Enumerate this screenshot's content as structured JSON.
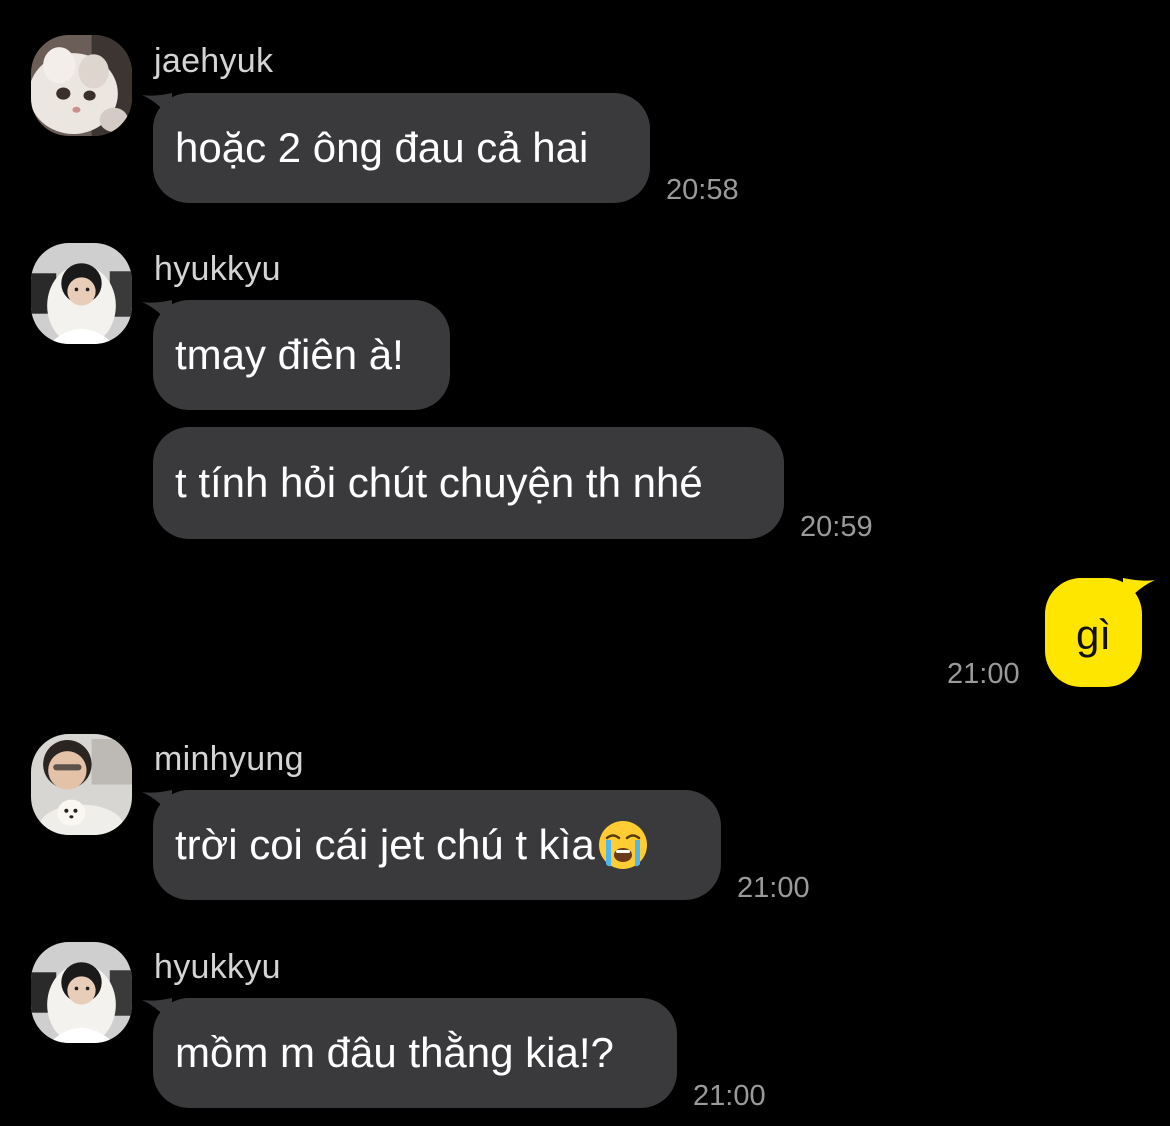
{
  "theme": {
    "background": "#000000",
    "incoming_bubble": "#3a3a3c",
    "outgoing_bubble": "#ffe600",
    "timestamp_color": "#9a9a9a",
    "sender_color": "#d4d4d4"
  },
  "messages": [
    {
      "sender": "jaehyuk",
      "avatar_icon": "cat-avatar-icon",
      "text": "hoặc 2 ông đau cả hai",
      "time": "20:58"
    },
    {
      "sender": "hyukkyu",
      "avatar_icon": "person-hood-avatar-icon",
      "text": "tmay điên à!",
      "time": ""
    },
    {
      "sender": "",
      "text": "t tính hỏi chút chuyện th nhé",
      "time": "20:59"
    },
    {
      "own": true,
      "text": "gì",
      "time": "21:00"
    },
    {
      "sender": "minhyung",
      "avatar_icon": "person-with-dog-avatar-icon",
      "text": "trời coi cái jet chú t kìa",
      "emoji": "loudly-crying-face-icon",
      "time": "21:00"
    },
    {
      "sender": "hyukkyu",
      "avatar_icon": "person-hood-avatar-icon",
      "text": "mồm m đâu thằng kia!?",
      "time": "21:00"
    }
  ]
}
